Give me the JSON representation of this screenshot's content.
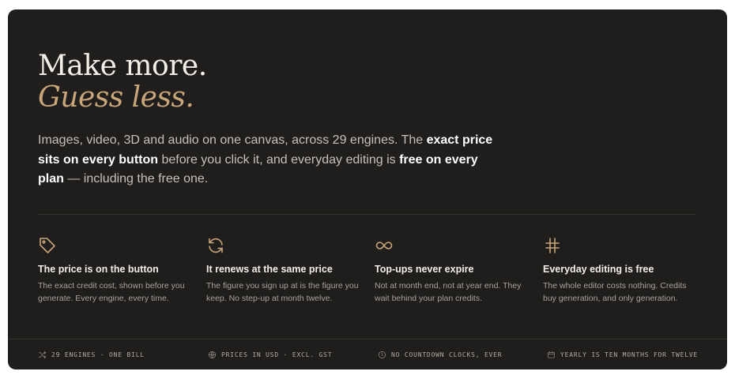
{
  "hero": {
    "title_line1": "Make more.",
    "title_line2": "Guess less."
  },
  "lede": {
    "part1": "Images, video, 3D and audio on one canvas, across 29 engines. The ",
    "bold1": "exact price sits on every button",
    "part2": " before you click it, and everyday editing is ",
    "bold2": "free on every plan",
    "part3": " — including the free one."
  },
  "features": [
    {
      "icon": "tag-icon",
      "title": "The price is on the button",
      "body": "The exact credit cost, shown before you generate. Every engine, every time."
    },
    {
      "icon": "refresh-icon",
      "title": "It renews at the same price",
      "body": "The figure you sign up at is the figure you keep. No step-up at month twelve."
    },
    {
      "icon": "infinity-icon",
      "title": "Top-ups never expire",
      "body": "Not at month end, not at year end. They wait behind your plan credits."
    },
    {
      "icon": "hash-icon",
      "title": "Everyday editing is free",
      "body": "The whole editor costs nothing. Credits buy generation, and only generation."
    }
  ],
  "footer": [
    {
      "icon": "shuffle-icon",
      "label": "29 ENGINES · ONE BILL"
    },
    {
      "icon": "globe-icon",
      "label": "PRICES IN USD · EXCL. GST"
    },
    {
      "icon": "clock-icon",
      "label": "NO COUNTDOWN CLOCKS, EVER"
    },
    {
      "icon": "calendar-icon",
      "label": "YEARLY IS TEN MONTHS FOR TWELVE"
    }
  ],
  "colors": {
    "background": "#1f1e1c",
    "accent": "#c9a67a",
    "heading": "#f3efe7",
    "body_text": "#c7c2b8",
    "muted_text": "#a8a398"
  }
}
